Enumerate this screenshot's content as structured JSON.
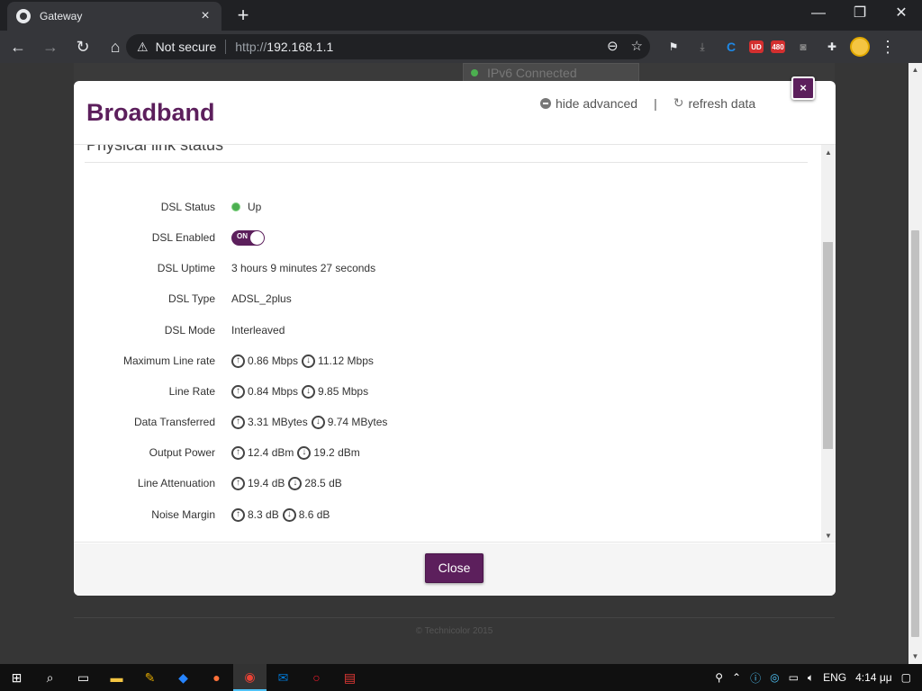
{
  "browser": {
    "tab_title": "Gateway",
    "tab_close": "×",
    "new_tab": "+",
    "security_label": "Not secure",
    "url_proto": "http://",
    "url_host": "192.168.1.1",
    "window_controls": [
      "—",
      "❐",
      "✕"
    ],
    "extensions": [
      "flag-icon",
      "download-icon",
      "c-icon",
      "ublock-icon",
      "480-icon",
      "bot-icon",
      "puzzle-icon"
    ],
    "ext_480_label": "480",
    "ext_ub_label": "UD"
  },
  "background_page": {
    "ipv6_text": "IPv6 Connected",
    "footer": "© Technicolor 2015"
  },
  "modal": {
    "title": "Broadband",
    "hide_advanced": "hide advanced",
    "separator": "|",
    "refresh_data": "refresh data",
    "close_x": "×",
    "section_title": "Physical link status",
    "close_button": "Close",
    "rows": [
      {
        "label": "DSL Status",
        "value": "Up"
      },
      {
        "label": "DSL Enabled",
        "toggle": "ON"
      },
      {
        "label": "DSL Uptime",
        "value": "3 hours 9 minutes 27 seconds"
      },
      {
        "label": "DSL Type",
        "value": "ADSL_2plus"
      },
      {
        "label": "DSL Mode",
        "value": "Interleaved"
      },
      {
        "label": "Maximum Line rate",
        "up": "0.86 Mbps",
        "down": "11.12 Mbps"
      },
      {
        "label": "Line Rate",
        "up": "0.84 Mbps",
        "down": "9.85 Mbps"
      },
      {
        "label": "Data Transferred",
        "up": "3.31 MBytes",
        "down": "9.74 MBytes"
      },
      {
        "label": "Output Power",
        "up": "12.4 dBm",
        "down": "19.2 dBm"
      },
      {
        "label": "Line Attenuation",
        "up": "19.4 dB",
        "down": "28.5 dB"
      },
      {
        "label": "Noise Margin",
        "up": "8.3 dB",
        "down": "8.6 dB"
      }
    ]
  },
  "taskbar": {
    "lang": "ENG",
    "time": "4:14 μμ"
  },
  "colors": {
    "brand": "#5c1f5c",
    "status_up": "#4caf50"
  }
}
